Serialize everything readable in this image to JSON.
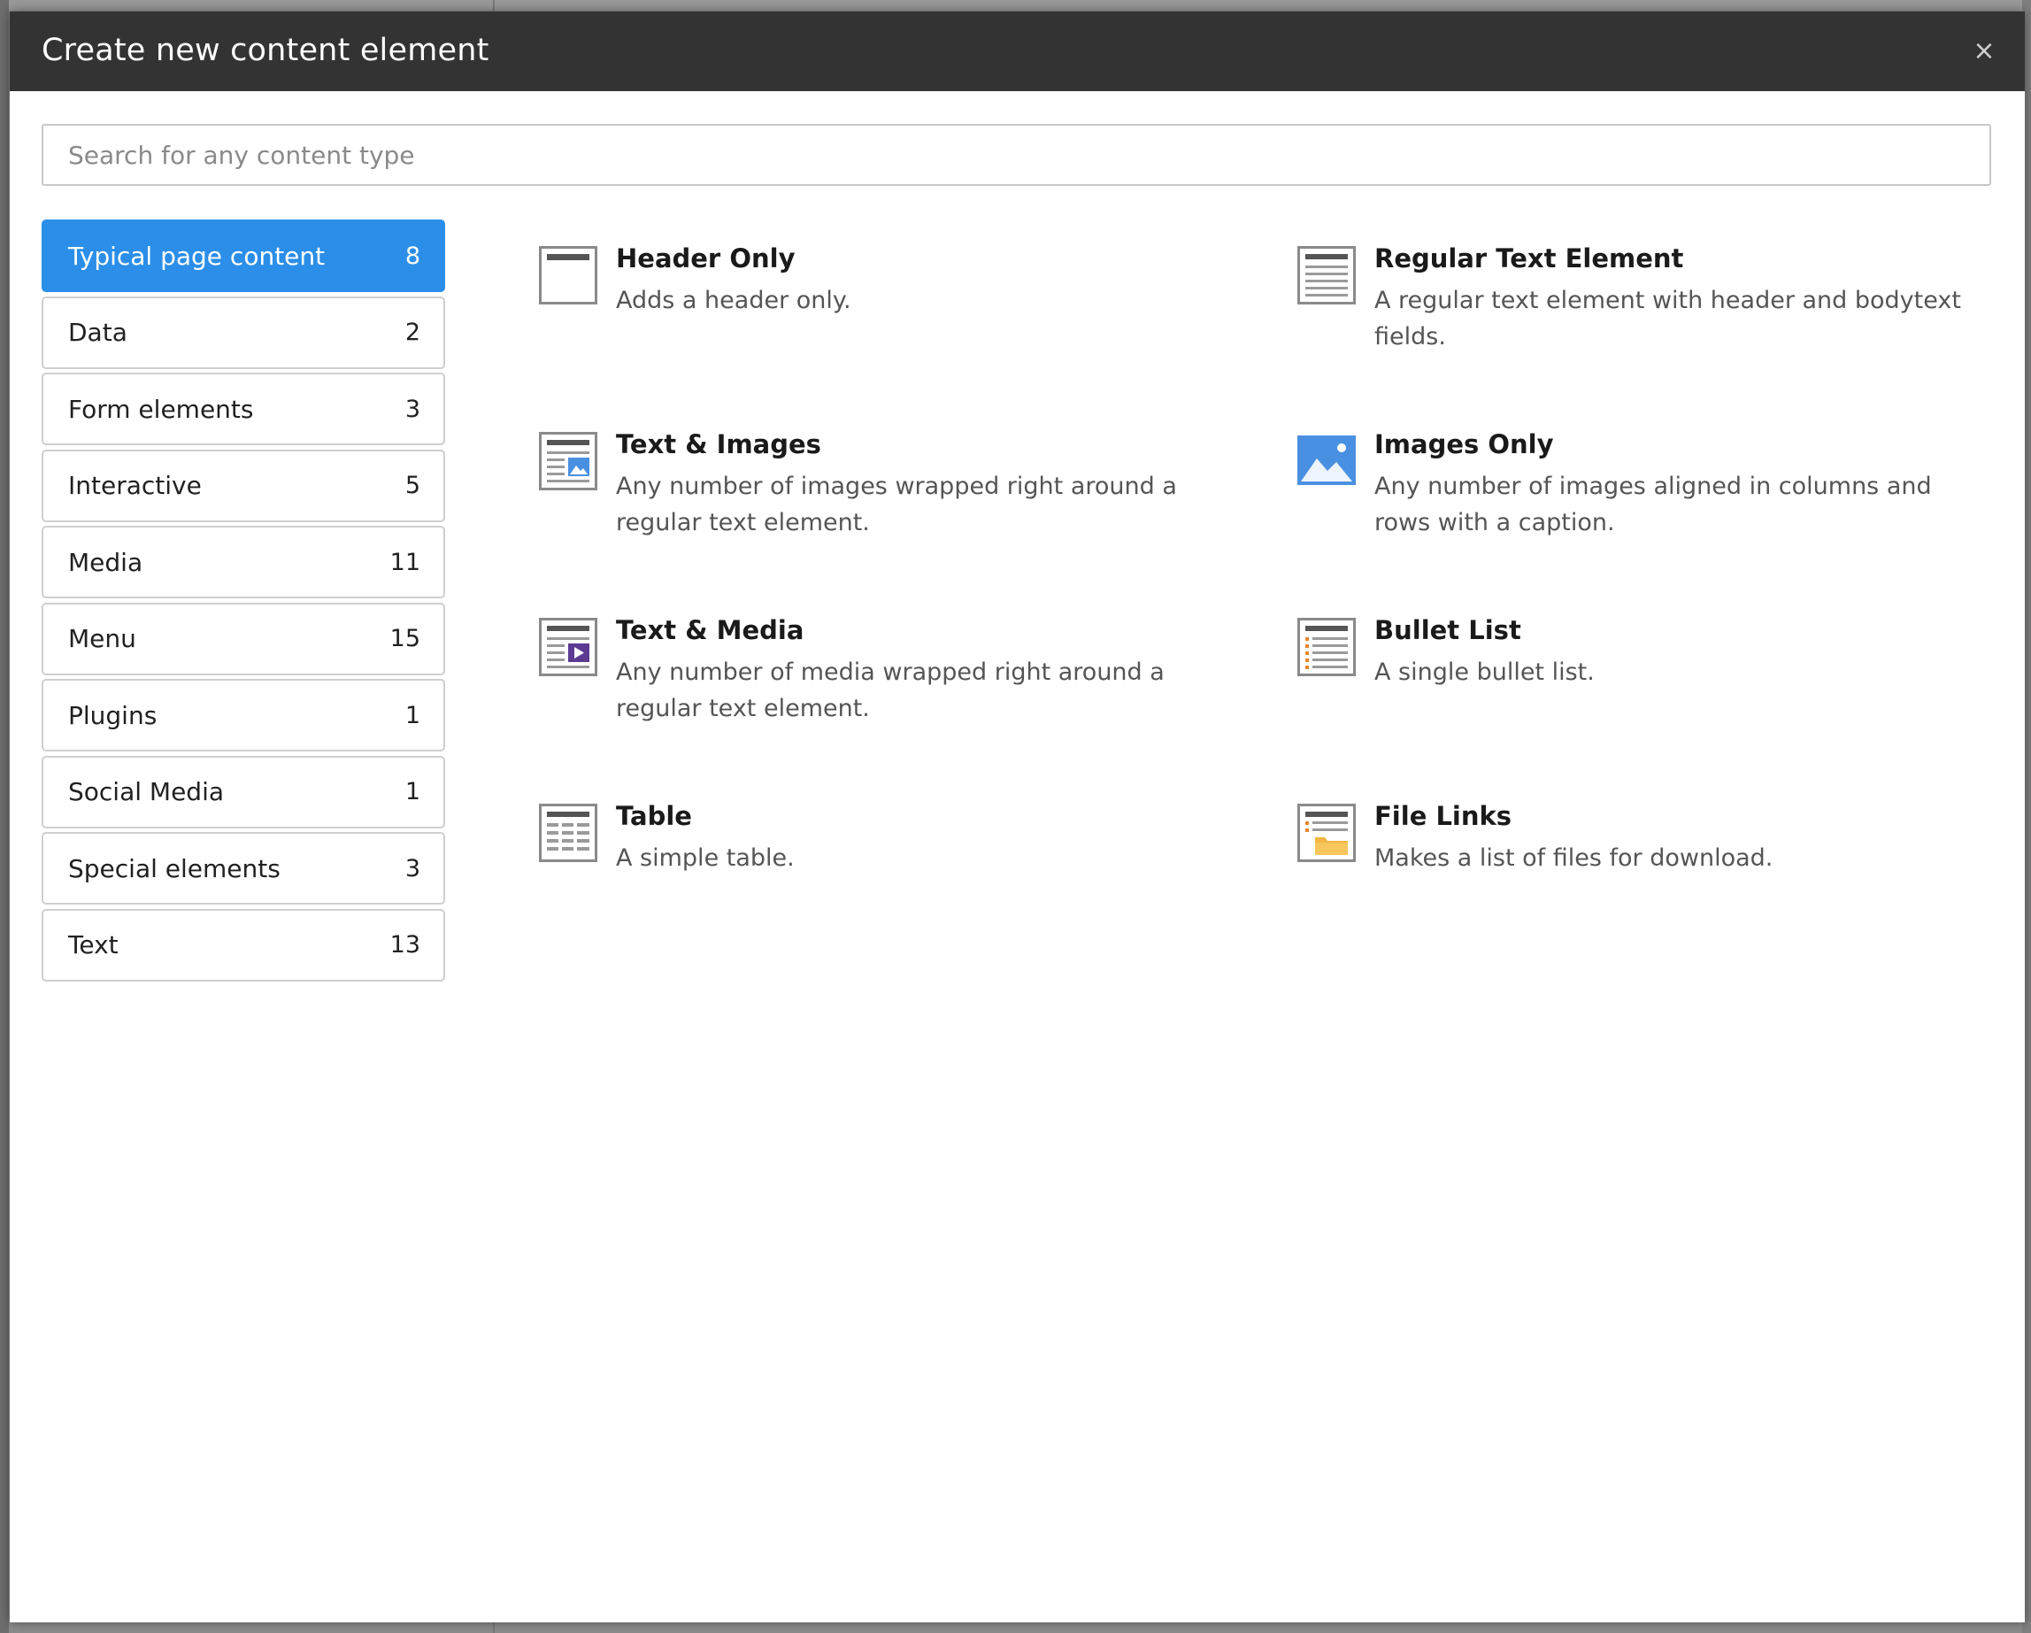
{
  "dialog": {
    "title": "Create new content element",
    "close_label": "×"
  },
  "search": {
    "placeholder": "Search for any content type",
    "value": ""
  },
  "categories": [
    {
      "label": "Typical page content",
      "count": "8",
      "active": true
    },
    {
      "label": "Data",
      "count": "2"
    },
    {
      "label": "Form elements",
      "count": "3"
    },
    {
      "label": "Interactive",
      "count": "5"
    },
    {
      "label": "Media",
      "count": "11"
    },
    {
      "label": "Menu",
      "count": "15"
    },
    {
      "label": "Plugins",
      "count": "1"
    },
    {
      "label": "Social Media",
      "count": "1"
    },
    {
      "label": "Special elements",
      "count": "3"
    },
    {
      "label": "Text",
      "count": "13"
    }
  ],
  "elements": [
    {
      "title": "Header Only",
      "description": "Adds a header only.",
      "icon": "header-only-icon"
    },
    {
      "title": "Regular Text Element",
      "description": "A regular text element with header and bodytext fields.",
      "icon": "regular-text-icon"
    },
    {
      "title": "Text & Images",
      "description": "Any number of images wrapped right around a regular text element.",
      "icon": "text-images-icon"
    },
    {
      "title": "Images Only",
      "description": "Any number of images aligned in columns and rows with a caption.",
      "icon": "images-only-icon"
    },
    {
      "title": "Text & Media",
      "description": "Any number of media wrapped right around a regular text element.",
      "icon": "text-media-icon"
    },
    {
      "title": "Bullet List",
      "description": "A single bullet list.",
      "icon": "bullet-list-icon"
    },
    {
      "title": "Table",
      "description": "A simple table.",
      "icon": "table-icon"
    },
    {
      "title": "File Links",
      "description": "Makes a list of files for download.",
      "icon": "file-links-icon"
    }
  ],
  "colors": {
    "header_bg": "#333333",
    "active_category": "#2b8ee8",
    "image_icon_blue": "#4a90e2",
    "media_icon_purple": "#5c3a92",
    "folder_icon_yellow": "#f4b542",
    "bullet_orange": "#e8862a"
  }
}
